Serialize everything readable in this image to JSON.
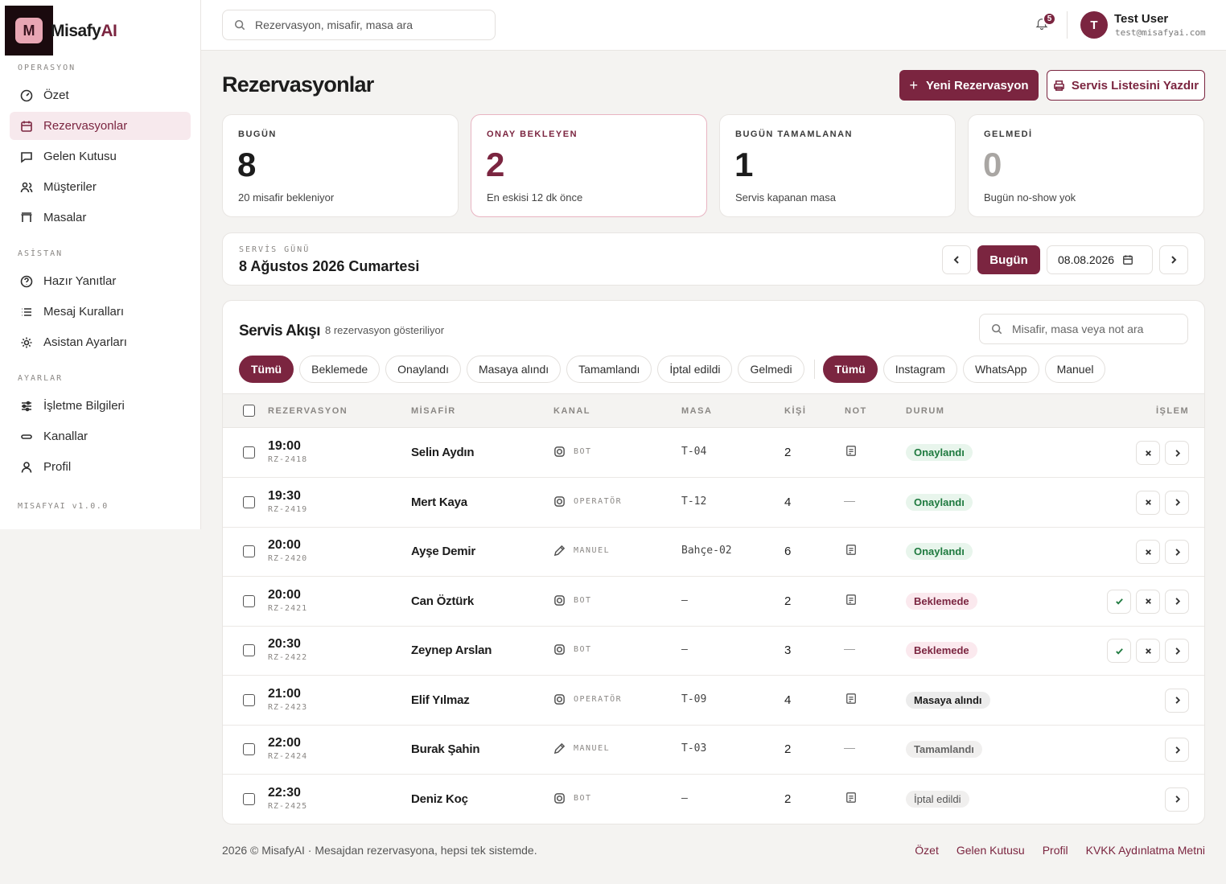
{
  "brand": {
    "initial": "M",
    "name_main": "Misafy",
    "name_accent": "AI",
    "version": "MISAFYAI v1.0.0"
  },
  "sidebar": {
    "sections": [
      {
        "title": "OPERASYON",
        "items": [
          {
            "label": "Özet",
            "icon": "gauge-icon"
          },
          {
            "label": "Rezervasyonlar",
            "icon": "calendar-icon",
            "active": true
          },
          {
            "label": "Gelen Kutusu",
            "icon": "chat-icon"
          },
          {
            "label": "Müşteriler",
            "icon": "users-icon"
          },
          {
            "label": "Masalar",
            "icon": "table-icon"
          }
        ]
      },
      {
        "title": "ASİSTAN",
        "items": [
          {
            "label": "Hazır Yanıtlar",
            "icon": "help-circle-icon"
          },
          {
            "label": "Mesaj Kuralları",
            "icon": "list-icon"
          },
          {
            "label": "Asistan Ayarları",
            "icon": "sun-gear-icon"
          }
        ]
      },
      {
        "title": "AYARLAR",
        "items": [
          {
            "label": "İşletme Bilgileri",
            "icon": "sliders-icon"
          },
          {
            "label": "Kanallar",
            "icon": "link-icon"
          },
          {
            "label": "Profil",
            "icon": "user-icon"
          }
        ]
      }
    ]
  },
  "topbar": {
    "search_placeholder": "Rezervasyon, misafir, masa ara",
    "notifications": "5",
    "user": {
      "initial": "T",
      "name": "Test User",
      "email": "test@misafyai.com"
    }
  },
  "page": {
    "title": "Rezervasyonlar",
    "new_button": "Yeni Rezervasyon",
    "print_button": "Servis Listesini Yazdır"
  },
  "stats": [
    {
      "label": "BUGÜN",
      "value": "8",
      "sub": "20 misafir bekleniyor"
    },
    {
      "label": "ONAY BEKLEYEN",
      "value": "2",
      "sub": "En eskisi 12 dk önce"
    },
    {
      "label": "BUGÜN TAMAMLANAN",
      "value": "1",
      "sub": "Servis kapanan masa"
    },
    {
      "label": "GELMEDİ",
      "value": "0",
      "sub": "Bugün no-show yok"
    }
  ],
  "service_day": {
    "label": "SERVİS GÜNÜ",
    "value": "8 Ağustos 2026 Cumartesi",
    "today": "Bugün",
    "date": "08.08.2026"
  },
  "flow": {
    "title": "Servis Akışı",
    "count": "8 rezervasyon gösteriliyor",
    "search_placeholder": "Misafir, masa veya not ara",
    "status_filters": [
      "Tümü",
      "Beklemede",
      "Onaylandı",
      "Masaya alındı",
      "Tamamlandı",
      "İptal edildi",
      "Gelmedi"
    ],
    "channel_filters": [
      "Tümü",
      "Instagram",
      "WhatsApp",
      "Manuel"
    ],
    "columns": {
      "res": "REZERVASYON",
      "guest": "MİSAFİR",
      "channel": "KANAL",
      "table": "MASA",
      "pax": "KİŞİ",
      "note": "NOT",
      "status": "DURUM",
      "action": "İŞLEM"
    },
    "no_note": "—",
    "rows": [
      {
        "time": "19:00",
        "id": "RZ-2418",
        "guest": "Selin Aydın",
        "channel": "BOT",
        "channel_icon": "instagram-icon",
        "table": "T-04",
        "pax": "2",
        "note": true,
        "status": "Onaylandı",
        "kind": "ok",
        "actions": [
          "x",
          "go"
        ]
      },
      {
        "time": "19:30",
        "id": "RZ-2419",
        "guest": "Mert Kaya",
        "channel": "OPERATÖR",
        "channel_icon": "instagram-icon",
        "table": "T-12",
        "pax": "4",
        "note": false,
        "status": "Onaylandı",
        "kind": "ok",
        "actions": [
          "x",
          "go"
        ]
      },
      {
        "time": "20:00",
        "id": "RZ-2420",
        "guest": "Ayşe Demir",
        "channel": "MANUEL",
        "channel_icon": "pencil-icon",
        "table": "Bahçe-02",
        "pax": "6",
        "note": true,
        "status": "Onaylandı",
        "kind": "ok",
        "actions": [
          "x",
          "go"
        ]
      },
      {
        "time": "20:00",
        "id": "RZ-2421",
        "guest": "Can Öztürk",
        "channel": "BOT",
        "channel_icon": "instagram-icon",
        "table": "—",
        "pax": "2",
        "note": true,
        "status": "Beklemede",
        "kind": "wait",
        "actions": [
          "ok",
          "x",
          "go"
        ]
      },
      {
        "time": "20:30",
        "id": "RZ-2422",
        "guest": "Zeynep Arslan",
        "channel": "BOT",
        "channel_icon": "instagram-icon",
        "table": "—",
        "pax": "3",
        "note": false,
        "status": "Beklemede",
        "kind": "wait",
        "actions": [
          "ok",
          "x",
          "go"
        ]
      },
      {
        "time": "21:00",
        "id": "RZ-2423",
        "guest": "Elif Yılmaz",
        "channel": "OPERATÖR",
        "channel_icon": "instagram-icon",
        "table": "T-09",
        "pax": "4",
        "note": true,
        "status": "Masaya alındı",
        "kind": "seat",
        "actions": [
          "go"
        ]
      },
      {
        "time": "22:00",
        "id": "RZ-2424",
        "guest": "Burak Şahin",
        "channel": "MANUEL",
        "channel_icon": "pencil-icon",
        "table": "T-03",
        "pax": "2",
        "note": false,
        "status": "Tamamlandı",
        "kind": "done",
        "actions": [
          "go"
        ]
      },
      {
        "time": "22:30",
        "id": "RZ-2425",
        "guest": "Deniz Koç",
        "channel": "BOT",
        "channel_icon": "instagram-icon",
        "table": "—",
        "pax": "2",
        "note": true,
        "status": "İptal edildi",
        "kind": "cancel",
        "actions": [
          "go"
        ]
      }
    ]
  },
  "footer": {
    "text": "2026 © MisafyAI · Mesajdan rezervasyona, hepsi tek sistemde.",
    "links": [
      "Özet",
      "Gelen Kutusu",
      "Profil",
      "KVKK Aydınlatma Metni"
    ]
  },
  "colors": {
    "brand": "#7b2540",
    "success": "#1f7a3f",
    "background": "#f4f3f1"
  }
}
